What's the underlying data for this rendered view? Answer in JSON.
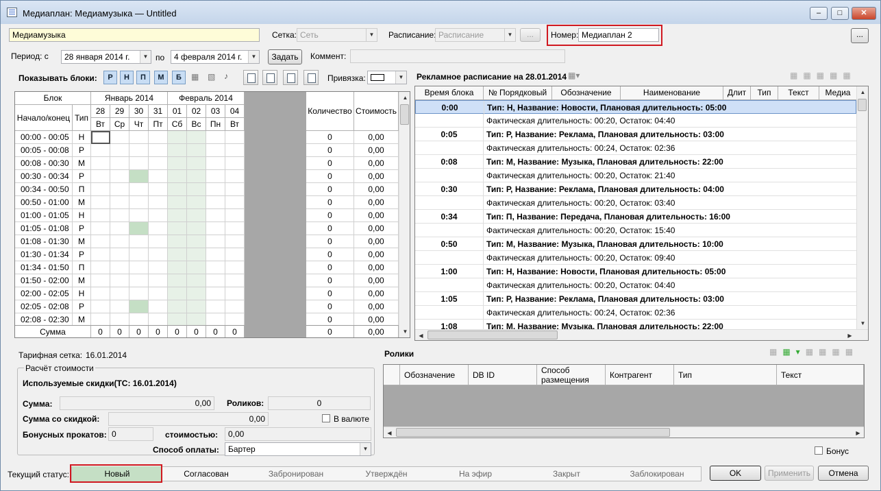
{
  "window": {
    "title": "Медиаплан: Медиамузыка — Untitled"
  },
  "header": {
    "name_value": "Медиамузыка",
    "grid_label": "Сетка:",
    "grid_value": "Сеть",
    "schedule_label": "Расписание:",
    "schedule_value": "Расписание",
    "ellipsis": "...",
    "number_label": "Номер:",
    "number_value": "Медиаплан 2",
    "period_label": "Период: с",
    "from_day": "28",
    "from_month": "января",
    "from_year": "2014 г.",
    "to_label": "по",
    "to_date": "4 февраля  2014 г.",
    "set_button": "Задать",
    "comment_label": "Коммент:"
  },
  "toolbar": {
    "show_blocks_label": "Показывать блоки:",
    "block_types": [
      "Р",
      "Н",
      "П",
      "М",
      "Б"
    ],
    "binding_label": "Привязка:"
  },
  "blocks_grid": {
    "col_block": "Блок",
    "col_start_end": "Начало/конец",
    "col_type": "Тип",
    "month1": "Январь 2014",
    "month2": "Февраль 2014",
    "days": [
      "28",
      "29",
      "30",
      "31",
      "01",
      "02",
      "03",
      "04"
    ],
    "weekdays": [
      "Вт",
      "Ср",
      "Чт",
      "Пт",
      "Сб",
      "Вс",
      "Пн",
      "Вт"
    ],
    "col_qty": "Количество",
    "col_cost": "Стоимость",
    "rows": [
      {
        "time": "00:00 - 00:05",
        "type": "Н",
        "qty": "0",
        "cost": "0,00"
      },
      {
        "time": "00:05 - 00:08",
        "type": "Р",
        "qty": "0",
        "cost": "0,00"
      },
      {
        "time": "00:08 - 00:30",
        "type": "М",
        "qty": "0",
        "cost": "0,00"
      },
      {
        "time": "00:30 - 00:34",
        "type": "Р",
        "qty": "0",
        "cost": "0,00"
      },
      {
        "time": "00:34 - 00:50",
        "type": "П",
        "qty": "0",
        "cost": "0,00"
      },
      {
        "time": "00:50 - 01:00",
        "type": "М",
        "qty": "0",
        "cost": "0,00"
      },
      {
        "time": "01:00 - 01:05",
        "type": "Н",
        "qty": "0",
        "cost": "0,00"
      },
      {
        "time": "01:05 - 01:08",
        "type": "Р",
        "qty": "0",
        "cost": "0,00"
      },
      {
        "time": "01:08 - 01:30",
        "type": "М",
        "qty": "0",
        "cost": "0,00"
      },
      {
        "time": "01:30 - 01:34",
        "type": "Р",
        "qty": "0",
        "cost": "0,00"
      },
      {
        "time": "01:34 - 01:50",
        "type": "П",
        "qty": "0",
        "cost": "0,00"
      },
      {
        "time": "01:50 - 02:00",
        "type": "М",
        "qty": "0",
        "cost": "0,00"
      },
      {
        "time": "02:00 - 02:05",
        "type": "Н",
        "qty": "0",
        "cost": "0,00"
      },
      {
        "time": "02:05 - 02:08",
        "type": "Р",
        "qty": "0",
        "cost": "0,00"
      },
      {
        "time": "02:08 - 02:30",
        "type": "М",
        "qty": "0",
        "cost": "0,00"
      }
    ],
    "sum_label": "Сумма",
    "sums": [
      "0",
      "0",
      "0",
      "0",
      "0",
      "0",
      "0",
      "0"
    ],
    "sum_qty": "0",
    "sum_cost": "0,00"
  },
  "schedule": {
    "title": "Рекламное расписание на 28.01.2014",
    "columns": [
      "Время блока",
      "№ Порядковый",
      "Обозначение",
      "Наименование",
      "Длит",
      "Тип",
      "Текст",
      "Медиа"
    ],
    "rows": [
      {
        "time": "0:00",
        "main": "Тип: Н, Название: Новости, Плановая длительность: 05:00",
        "sub": "Фактическая длительность: 00:20, Остаток: 04:40"
      },
      {
        "time": "0:05",
        "main": "Тип: Р, Название: Реклама, Плановая длительность: 03:00",
        "sub": "Фактическая длительность: 00:24, Остаток: 02:36"
      },
      {
        "time": "0:08",
        "main": "Тип: М, Название: Музыка, Плановая длительность: 22:00",
        "sub": "Фактическая длительность: 00:20, Остаток: 21:40"
      },
      {
        "time": "0:30",
        "main": "Тип: Р, Название: Реклама, Плановая длительность: 04:00",
        "sub": "Фактическая длительность: 00:20, Остаток: 03:40"
      },
      {
        "time": "0:34",
        "main": "Тип: П, Название: Передача, Плановая длительность: 16:00",
        "sub": "Фактическая длительность: 00:20, Остаток: 15:40"
      },
      {
        "time": "0:50",
        "main": "Тип: М, Название: Музыка, Плановая длительность: 10:00",
        "sub": "Фактическая длительность: 00:20, Остаток: 09:40"
      },
      {
        "time": "1:00",
        "main": "Тип: Н, Название: Новости, Плановая длительность: 05:00",
        "sub": "Фактическая длительность: 00:20, Остаток: 04:40"
      },
      {
        "time": "1:05",
        "main": "Тип: Р, Название: Реклама, Плановая длительность: 03:00",
        "sub": "Фактическая длительность: 00:24, Остаток: 02:36"
      },
      {
        "time": "1:08",
        "main": "Тип: М, Название: Музыка, Плановая длительность: 22:00",
        "sub": ""
      }
    ]
  },
  "tariff": {
    "label": "Тарифная сетка:",
    "value": "16.01.2014"
  },
  "calc": {
    "legend": "Расчёт стоимости",
    "discounts": "Используемые скидки(ТС: 16.01.2014)",
    "sum_label": "Сумма:",
    "sum_value": "0,00",
    "clips_label": "Роликов:",
    "clips_value": "0",
    "discount_sum_label": "Сумма со скидкой:",
    "discount_sum_value": "0,00",
    "currency_label": "В валюте",
    "bonus_label": "Бонусных прокатов:",
    "bonus_value": "0",
    "cost_label": "стоимостью:",
    "cost_value": "0,00",
    "payment_label": "Способ оплаты:",
    "payment_value": "Бартер"
  },
  "clips": {
    "title": "Ролики",
    "columns": [
      "Обозначение",
      "DB ID",
      "Способ размещения",
      "Контрагент",
      "Тип",
      "Текст"
    ],
    "bonus_label": "Бонус"
  },
  "status": {
    "label": "Текущий статус:",
    "items": [
      "Новый",
      "Согласован",
      "Забронирован",
      "Утверждён",
      "На эфир",
      "Закрыт",
      "Заблокирован"
    ]
  },
  "buttons": {
    "ok": "OK",
    "apply": "Применить",
    "cancel": "Отмена"
  },
  "colors": {
    "accent": "#c5dfc5",
    "selection": "#cfe0f7",
    "red": "#d01820"
  }
}
